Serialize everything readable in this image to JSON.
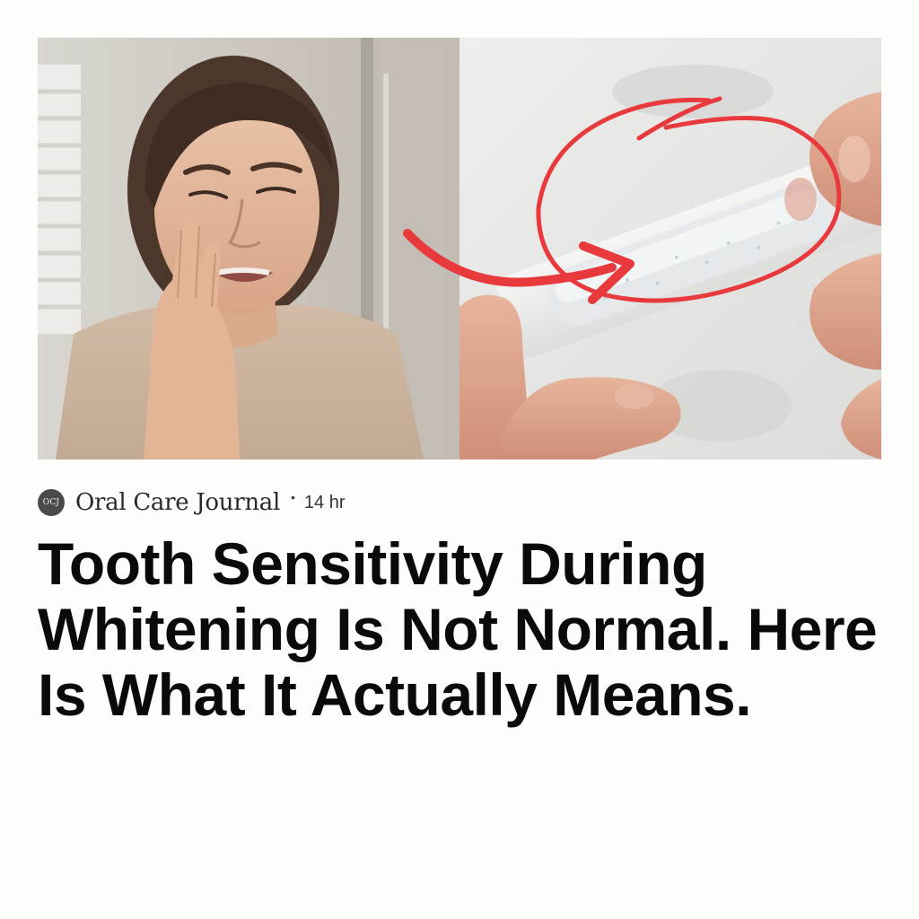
{
  "article": {
    "publisher": {
      "logo_text": "OCJ",
      "name": "Oral Care Journal"
    },
    "separator": "•",
    "time_ago": "14 hr",
    "headline": "Tooth Sensitivity During Whitening Is Not Normal. Here Is What It Actually Means.",
    "image": {
      "left_subject": "woman-holding-cheek-in-pain",
      "right_subject": "whitening-strip-in-fingers",
      "annotation_color": "#e8393d"
    }
  }
}
